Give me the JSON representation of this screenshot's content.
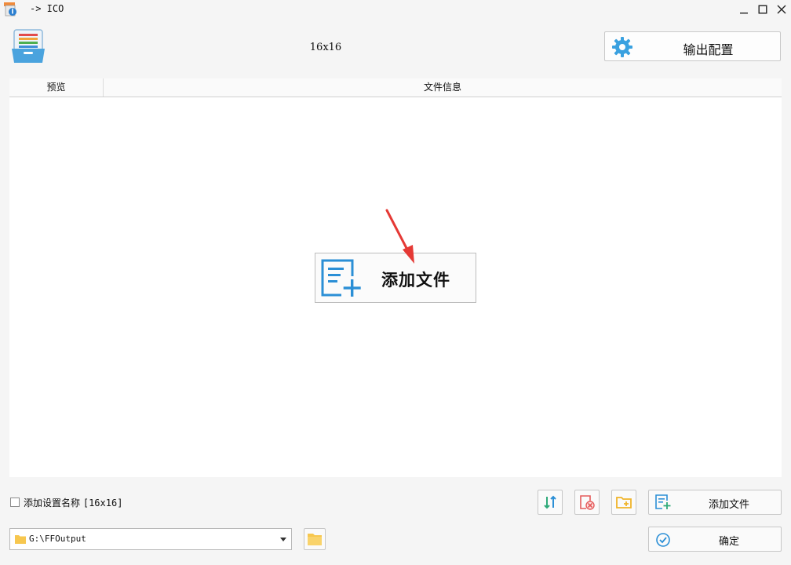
{
  "window": {
    "title": "-> ICO",
    "icons": {
      "app": "app-icon",
      "minimize": "minimize-icon",
      "maximize": "maximize-icon",
      "close": "close-icon"
    }
  },
  "header": {
    "logo_icon": "file-list-logo-icon",
    "size_label": "16x16",
    "output_config_label": "输出配置",
    "output_config_icon": "gear-icon"
  },
  "table": {
    "columns": [
      "预览",
      "文件信息"
    ],
    "rows": []
  },
  "center": {
    "add_file_label": "添加文件",
    "add_file_icon": "add-file-icon"
  },
  "bottom": {
    "checkbox_checked": false,
    "checkbox_label": "添加设置名称",
    "checkbox_suffix": "[16x16]",
    "add_file_label": "添加文件",
    "confirm_label": "确定",
    "output_path": "G:\\FFOutput"
  },
  "colors": {
    "accent_blue": "#2b8fd6",
    "gear_blue": "#3aa1e0",
    "clear_red": "#e45a5a",
    "folder_yellow": "#f2c14e",
    "sort_green": "#2faa7a",
    "annotation_red": "#e53935"
  }
}
